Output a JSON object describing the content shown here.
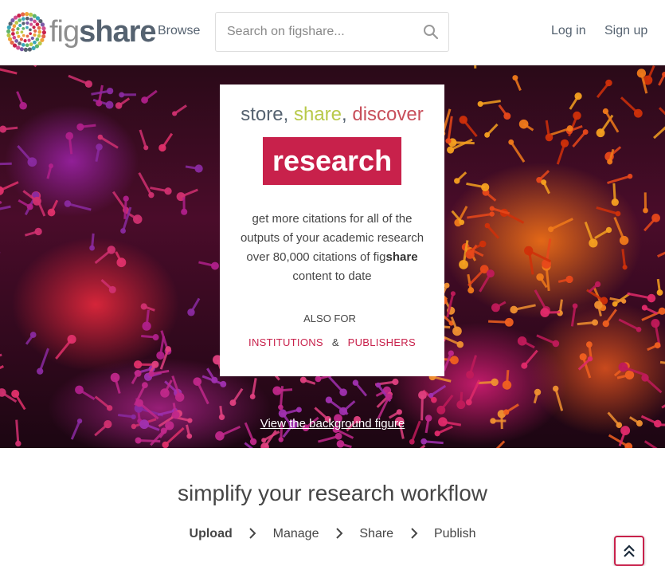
{
  "header": {
    "logo_fig": "fig",
    "logo_share": "share",
    "browse_label": "Browse",
    "search_placeholder": "Search on figshare...",
    "login_label": "Log in",
    "signup_label": "Sign up"
  },
  "hero": {
    "tagline_store": "store",
    "tagline_share": "share",
    "tagline_discover": "discover",
    "research_label": "research",
    "desc_before": "get more citations for all of the outputs of your academic research over 80,000 citations of fig",
    "desc_bold": "share",
    "desc_after": " content to date",
    "also_for": "ALSO FOR",
    "institutions_label": "INSTITUTIONS",
    "amp": "&",
    "publishers_label": "PUBLISHERS",
    "background_link": "View the background figure"
  },
  "workflow": {
    "title": "simplify your research workflow",
    "steps": [
      "Upload",
      "Manage",
      "Share",
      "Publish"
    ]
  },
  "colors": {
    "brand_red": "#c8214b",
    "brand_green": "#b8c94a",
    "text_dark": "#556270"
  },
  "icons": {
    "search": "search-icon",
    "logo": "figshare-logo-icon",
    "chevron": "chevron-right-icon",
    "back_to_top": "double-chevron-up-icon"
  }
}
